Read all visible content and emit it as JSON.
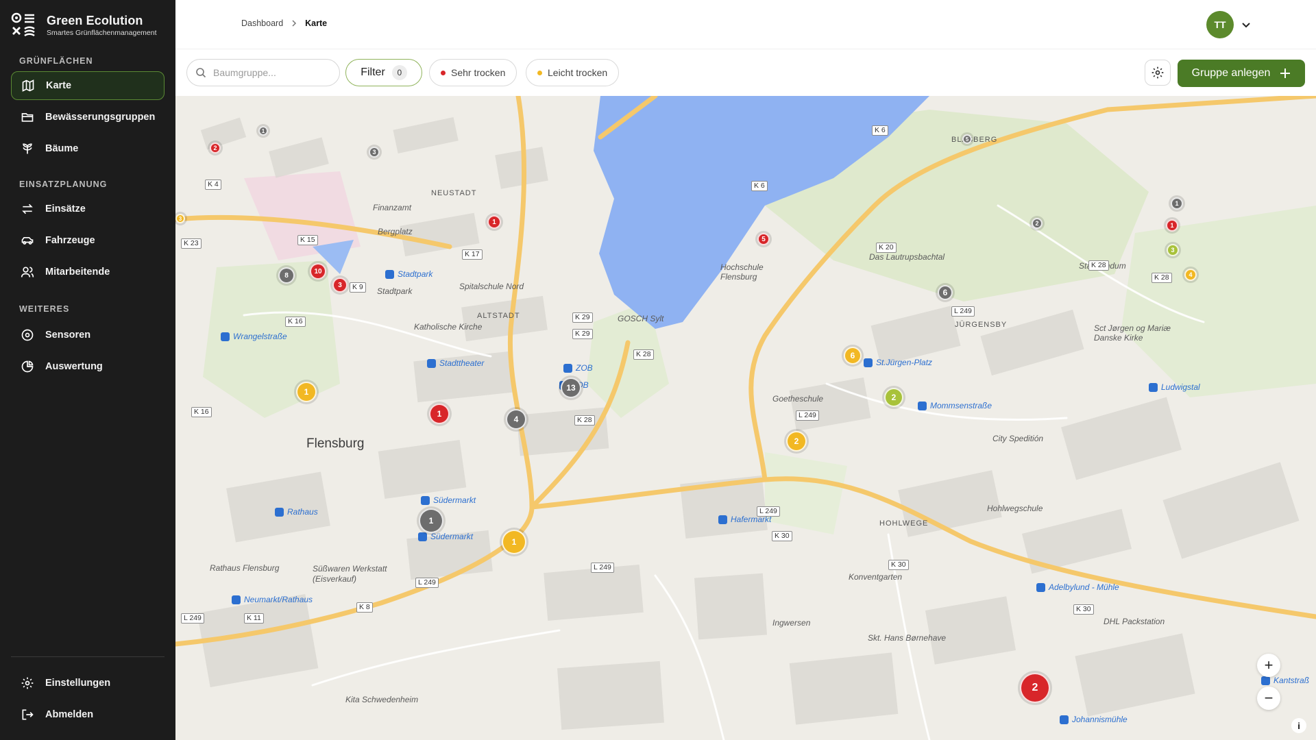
{
  "brand": {
    "name": "Green Ecolution",
    "subtitle": "Smartes Grünflächenmanagement"
  },
  "sidebar": {
    "sections": [
      {
        "label": "GRÜNFLÄCHEN"
      },
      {
        "label": "EINSATZPLANUNG"
      },
      {
        "label": "WEITERES"
      }
    ],
    "items": [
      {
        "label": "Karte",
        "icon": "map-icon",
        "active": true
      },
      {
        "label": "Bewässerungsgruppen",
        "icon": "folder-icon"
      },
      {
        "label": "Bäume",
        "icon": "tree-icon"
      },
      {
        "label": "Einsätze",
        "icon": "arrows-swap-icon"
      },
      {
        "label": "Fahrzeuge",
        "icon": "car-icon"
      },
      {
        "label": "Mitarbeitende",
        "icon": "users-icon"
      },
      {
        "label": "Sensoren",
        "icon": "sensor-icon"
      },
      {
        "label": "Auswertung",
        "icon": "pie-chart-icon"
      }
    ],
    "footer": [
      {
        "label": "Einstellungen",
        "icon": "gear-icon"
      },
      {
        "label": "Abmelden",
        "icon": "logout-icon"
      }
    ]
  },
  "header": {
    "breadcrumb": [
      "Dashboard",
      "Karte"
    ],
    "user_initials": "TT"
  },
  "toolbar": {
    "search_placeholder": "Baumgruppe...",
    "filter_label": "Filter",
    "filter_count": "0",
    "chips": [
      {
        "label": "Sehr trocken",
        "color": "#d8262a"
      },
      {
        "label": "Leicht trocken",
        "color": "#f2b823"
      }
    ],
    "create_label": "Gruppe anlegen"
  },
  "map": {
    "places": {
      "flensburg": "Flensburg",
      "hohlwege": "HOHLWEGE",
      "juergensby": "JÜRGENSBY",
      "blasberg": "BLASBERG",
      "altstadt": "ALTSTADT",
      "neustadt": "NEUSTADT",
      "goethe": "Goetheschule",
      "hohlweg_schule": "Hohlwegschule",
      "konventgarten": "Konventgarten",
      "ingwersen": "Ingwersen",
      "hans": "Skt. Hans Børnehave",
      "kita": "Kita Schwedenheim",
      "rathaus_fl": "Rathaus Flensburg",
      "suesswaren": "Süßwaren Werkstatt (Eisverkauf)",
      "dhl": "DHL Packstation",
      "sct": "Sct Jørgen og Mariæ Danske Kirke",
      "lautrup": "Das Lautrupsbachtal",
      "stadtrundum": "Stadtrundum",
      "city": "City Speditión",
      "gosch": "GOSCH Sylt",
      "hochschule": "Hochschule Flensburg",
      "spitalschule": "Spitalschule Nord",
      "katholische": "Katholische Kirche",
      "finanzamt": "Finanzamt",
      "bergplatz": "Bergplatz",
      "stadtpark": "Stadtpark"
    },
    "transit": {
      "zob": "ZOB",
      "zob2": "ZOB",
      "suedermarkt": "Südermarkt",
      "suedermarkt2": "Südermarkt",
      "rathaus": "Rathaus",
      "neumarkt": "Neumarkt/Rathaus",
      "stadttheater": "Stadttheater",
      "stjuergen": "St.Jürgen-Platz",
      "mommsen": "Mommsenstraße",
      "ludwigstal": "Ludwigstal",
      "hafermarkt": "Hafermarkt",
      "adelby": "Adelbylund - Mühle",
      "johannis": "Johannismühle",
      "kantstr": "Kantstraß",
      "wrangel": "Wrangelstraße",
      "stadtpark2": "Stadtpark"
    },
    "roads": [
      "K 28",
      "K 28",
      "L 249",
      "L 249",
      "L 249",
      "K 30",
      "K 30",
      "L 249",
      "K 8",
      "K 11",
      "L 249",
      "K 29",
      "K 29",
      "K 17",
      "K 9",
      "K 16",
      "K 30",
      "L 249",
      "K 20",
      "K 28",
      "K 28",
      "K 6",
      "K 6",
      "K 16",
      "K 23",
      "K 4",
      "K 15"
    ],
    "clusters": [
      {
        "count": "1",
        "color": "yellow"
      },
      {
        "count": "1",
        "color": "red"
      },
      {
        "count": "4",
        "color": "gray"
      },
      {
        "count": "13",
        "color": "gray"
      },
      {
        "count": "1",
        "color": "gray"
      },
      {
        "count": "1",
        "color": "yellow"
      },
      {
        "count": "2",
        "color": "yellow"
      },
      {
        "count": "2",
        "color": "green"
      },
      {
        "count": "6",
        "color": "yellow"
      },
      {
        "count": "6",
        "color": "gray"
      },
      {
        "count": "5",
        "color": "red"
      },
      {
        "count": "1",
        "color": "red"
      },
      {
        "count": "10",
        "color": "red"
      },
      {
        "count": "3",
        "color": "red"
      },
      {
        "count": "8",
        "color": "gray"
      },
      {
        "count": "2",
        "color": "red"
      },
      {
        "count": "3",
        "color": "gray"
      },
      {
        "count": "1",
        "color": "gray"
      },
      {
        "count": "1",
        "color": "red"
      },
      {
        "count": "3",
        "color": "green"
      },
      {
        "count": "4",
        "color": "yellow"
      },
      {
        "count": "2",
        "color": "gray"
      },
      {
        "count": "1",
        "color": "gray"
      },
      {
        "count": "3",
        "color": "yellow"
      },
      {
        "count": "5",
        "color": "gray"
      },
      {
        "count": "2",
        "color": "red"
      }
    ],
    "zoom_in": "+",
    "zoom_out": "−",
    "attribution": "i"
  }
}
